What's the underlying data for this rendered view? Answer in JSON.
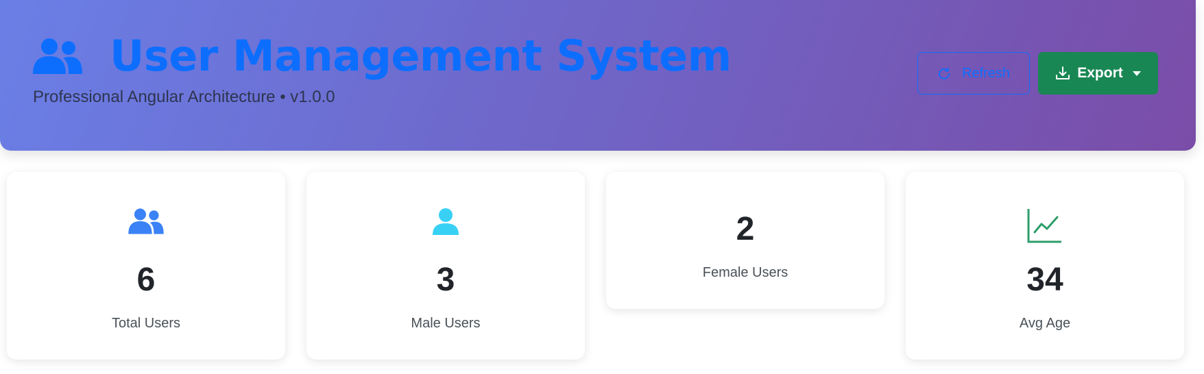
{
  "header": {
    "title": "User Management System",
    "subtitle": "Professional Angular Architecture • v1.0.0",
    "icon": "users-icon",
    "refresh_label": "Refresh",
    "export_label": "Export"
  },
  "colors": {
    "title": "#0d6efd",
    "refresh": "#0d6efd",
    "export_bg": "#198754",
    "total_icon": "#3b82f6",
    "male_icon": "#38d1f5",
    "avg_icon": "#2e9e6b"
  },
  "stats": [
    {
      "icon": "users-icon",
      "value": "6",
      "label": "Total Users"
    },
    {
      "icon": "user-icon",
      "value": "3",
      "label": "Male Users"
    },
    {
      "icon": "",
      "value": "2",
      "label": "Female Users"
    },
    {
      "icon": "chart-line-icon",
      "value": "34",
      "label": "Avg Age"
    }
  ]
}
